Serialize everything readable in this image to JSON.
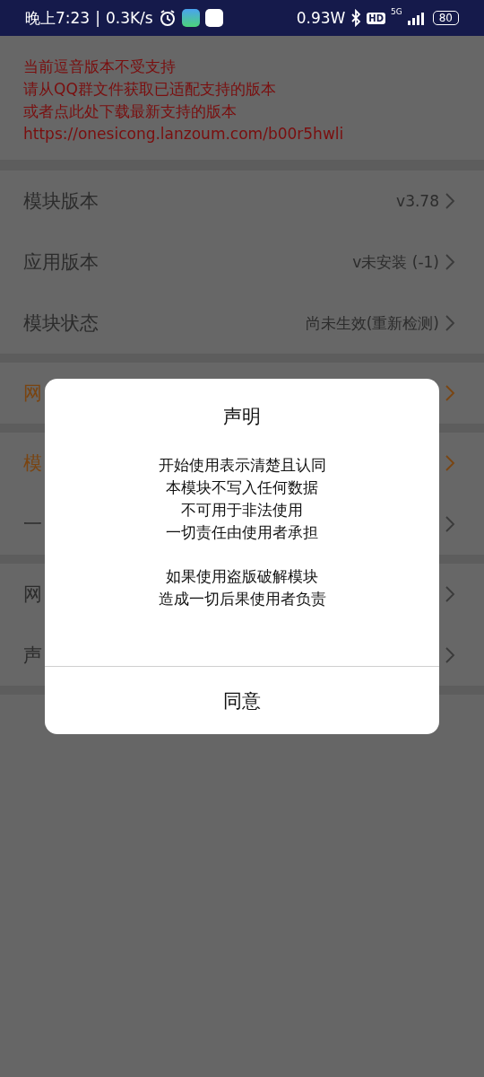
{
  "status_bar": {
    "time": "晚上7:23",
    "separator": "|",
    "speed": "0.3K/s",
    "power": "0.93W",
    "hd": "HD",
    "network": "5G",
    "battery": "80"
  },
  "notice": {
    "lines": [
      "当前逗音版本不受支持",
      "请从QQ群文件获取已适配支持的版本",
      "或者点此处下载最新支持的版本"
    ],
    "link": "https://onesicong.lanzoum.com/b00r5hwli"
  },
  "groups": [
    {
      "rows": [
        {
          "label": "模块版本",
          "value": "v3.78",
          "accent": false
        },
        {
          "label": "应用版本",
          "value": "v未安装 (-1)",
          "accent": false
        },
        {
          "label": "模块状态",
          "value": "尚未生效(重新检测)",
          "accent": false
        }
      ]
    },
    {
      "rows": [
        {
          "label": "网",
          "accent": true
        }
      ]
    },
    {
      "rows": [
        {
          "label": "模",
          "accent": true
        },
        {
          "label": "一",
          "accent": false
        }
      ]
    },
    {
      "rows": [
        {
          "label": "网",
          "accent": false
        },
        {
          "label": "声",
          "accent": false
        }
      ]
    }
  ],
  "dialog": {
    "title": "声明",
    "paragraphs": [
      [
        "开始使用表示清楚且认同",
        "本模块不写入任何数据",
        "不可用于非法使用",
        "一切责任由使用者承担"
      ],
      [
        "如果使用盗版破解模块",
        "造成一切后果使用者负责"
      ]
    ],
    "button": "同意"
  }
}
